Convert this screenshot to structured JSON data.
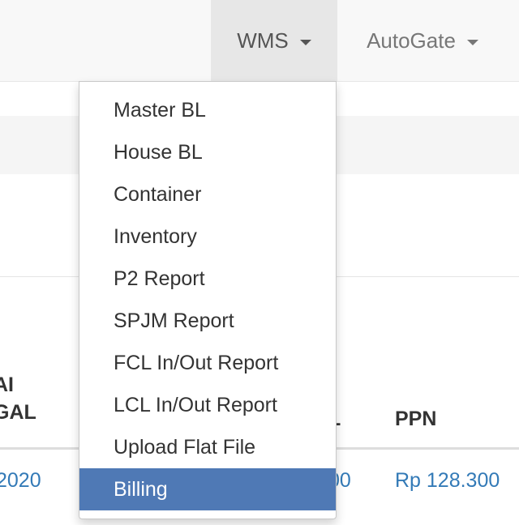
{
  "navbar": {
    "wms_label": "WMS",
    "autogate_label": "AutoGate"
  },
  "dropdown": {
    "items": [
      {
        "label": "Master BL"
      },
      {
        "label": "House BL"
      },
      {
        "label": "Container"
      },
      {
        "label": "Inventory"
      },
      {
        "label": "P2 Report"
      },
      {
        "label": "SPJM Report"
      },
      {
        "label": "FCL In/Out Report"
      },
      {
        "label": "LCL In/Out Report"
      },
      {
        "label": "Upload Flat File"
      },
      {
        "label": "Billing"
      }
    ],
    "active_index": 9
  },
  "table": {
    "headers": {
      "tanggal_line1": "AI",
      "tanggal_line2": "GAL",
      "total": "L",
      "ppn": "PPN"
    },
    "row": {
      "date": "2020",
      "total": "00",
      "ppn": "Rp 128.300"
    }
  },
  "colors": {
    "active_item": "#4f79b5",
    "link": "#337ab7",
    "navbar_bg": "#f8f8f8"
  }
}
